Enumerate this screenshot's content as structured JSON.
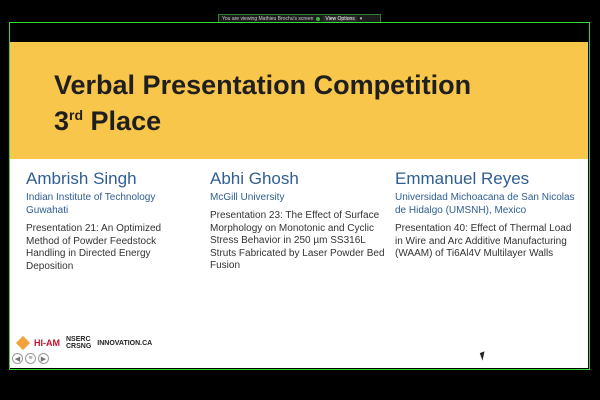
{
  "screen_share": {
    "banner_text": "You are viewing Mathieu Brochu's screen",
    "view_options_label": "View Options"
  },
  "slide": {
    "title_main": "Verbal Presentation Competition",
    "title_place_number": "3",
    "title_place_suffix": "rd",
    "title_place_word": "Place",
    "presenters": [
      {
        "name": "Ambrish Singh",
        "institution": "Indian Institute of Technology Guwahati",
        "presentation": "Presentation 21: An Optimized Method of Powder Feedstock Handling in Directed Energy Deposition"
      },
      {
        "name": "Abhi Ghosh",
        "institution": "McGill University",
        "presentation": "Presentation 23: The Effect of Surface Morphology on Monotonic and Cyclic Stress Behavior in 250 µm SS316L Struts Fabricated by Laser Powder Bed Fusion"
      },
      {
        "name": "Emmanuel Reyes",
        "institution": "Universidad Michoacana de San Nicolas de Hidalgo (UMSNH), Mexico",
        "presentation": "Presentation 40: Effect of Thermal Load in Wire and Arc Additive Manufacturing (WAAM) of Ti6Al4V Multilayer Walls"
      }
    ],
    "logos": {
      "hiam": "HI-AM",
      "nserc": "NSERC",
      "crsng": "CRSNG",
      "innovation": "INNOVATION.CA"
    }
  },
  "colors": {
    "banner": "#f7c64a",
    "name_text": "#2f5e92",
    "share_border": "#2fdc2f"
  }
}
